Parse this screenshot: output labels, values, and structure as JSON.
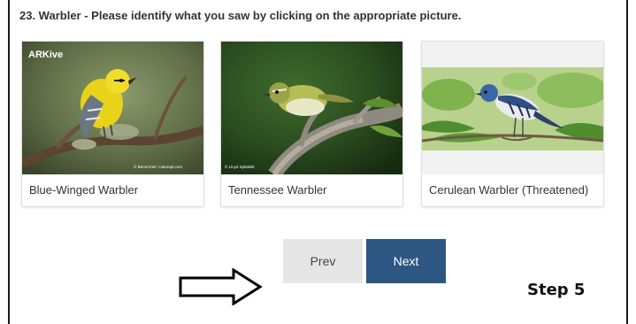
{
  "question": {
    "text": "23. Warbler - Please identify what you saw by clicking on the appropriate picture."
  },
  "choices": [
    {
      "label": "Blue-Winged Warbler",
      "photo_watermark": "ARKive",
      "photo_credit": "© Bernd Kiel / naturepl.com"
    },
    {
      "label": "Tennessee Warbler",
      "photo_credit": "© Lloyd Spitalnik"
    },
    {
      "label": "Cerulean Warbler (Threatened)"
    }
  ],
  "nav": {
    "prev_label": "Prev",
    "next_label": "Next"
  },
  "annotation": {
    "step_label": "Step 5",
    "arrow_icon": "right-arrow-outline"
  },
  "colors": {
    "next_button": "#2e5683",
    "prev_button": "#e6e6e6"
  }
}
